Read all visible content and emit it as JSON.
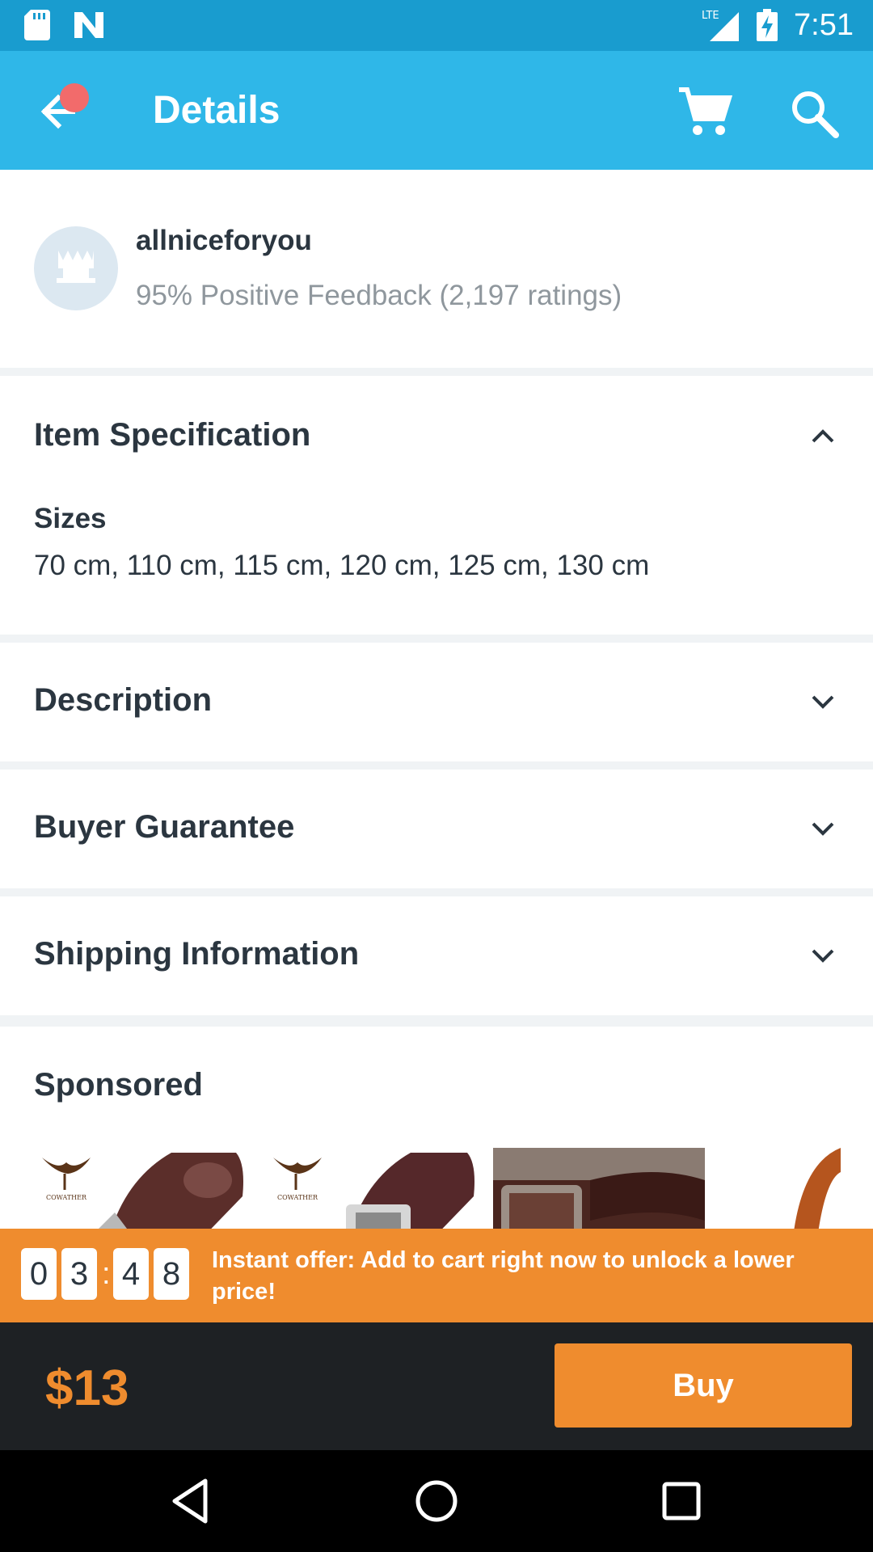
{
  "status_bar": {
    "time": "7:51",
    "network": "LTE"
  },
  "app_bar": {
    "title": "Details"
  },
  "seller": {
    "name": "allniceforyou",
    "feedback": "95% Positive Feedback (2,197 ratings)"
  },
  "item_spec": {
    "title": "Item Specification",
    "sizes_label": "Sizes",
    "sizes_value": "70 cm, 110 cm, 115 cm, 120 cm, 125 cm, 130 cm"
  },
  "sections": {
    "description": "Description",
    "buyer_guarantee": "Buyer Guarantee",
    "shipping": "Shipping Information"
  },
  "sponsored": {
    "title": "Sponsored",
    "brand": "COWATHER"
  },
  "offer": {
    "timer_digits": [
      "0",
      "3",
      "4",
      "8"
    ],
    "text": "Instant offer: Add to cart right now to unlock a lower price!"
  },
  "buy_bar": {
    "price": "$13",
    "buy_label": "Buy"
  },
  "colors": {
    "accent": "#ef8c2e",
    "app_bar": "#2fb7e8",
    "status_bar": "#199ccf"
  }
}
